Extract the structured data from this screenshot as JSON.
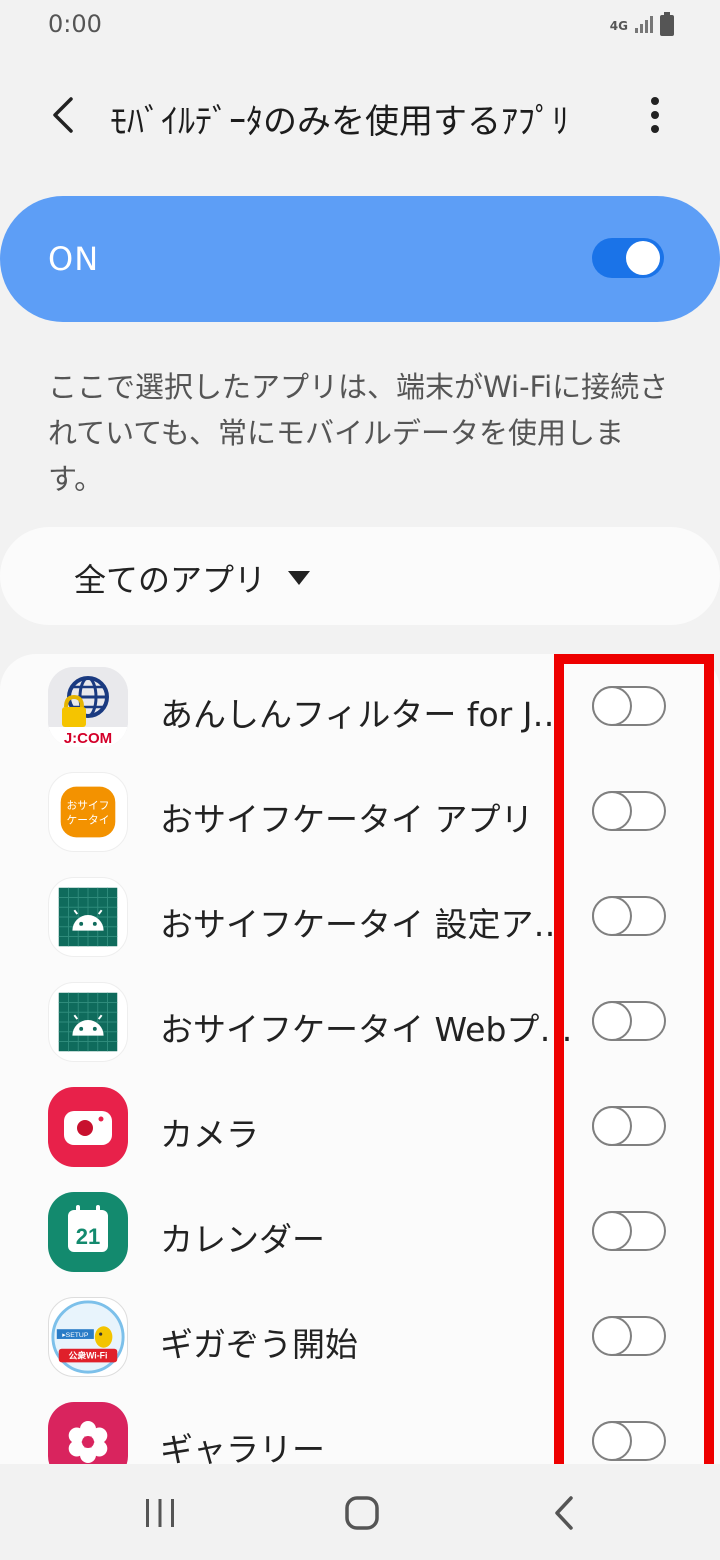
{
  "status_bar": {
    "time": "0:00",
    "network": "4G"
  },
  "header": {
    "title": "ﾓﾊﾞｲﾙﾃﾞｰﾀのみを使用するｱﾌﾟﾘ"
  },
  "master": {
    "label": "ON",
    "state": "on",
    "accent": "#5d9ef6"
  },
  "description": "ここで選択したアプリは、端末がWi-Fiに接続されていても、常にモバイルデータを使用します。",
  "filter": {
    "selected": "全てのアプリ"
  },
  "apps": [
    {
      "name": "あんしんフィルター for J:COM",
      "icon": "anshin-filter-icon",
      "enabled": false
    },
    {
      "name": "おサイフケータイ アプリ",
      "icon": "osaifu-keitai-icon",
      "enabled": false
    },
    {
      "name": "おサイフケータイ 設定アプリ",
      "icon": "android-icon",
      "enabled": false
    },
    {
      "name": "おサイフケータイ Webプラグイン",
      "icon": "android-icon",
      "enabled": false
    },
    {
      "name": "カメラ",
      "icon": "camera-icon",
      "enabled": false
    },
    {
      "name": "カレンダー",
      "icon": "calendar-icon",
      "enabled": false
    },
    {
      "name": "ギガぞう開始",
      "icon": "gigazo-icon",
      "enabled": false
    },
    {
      "name": "ギャラリー",
      "icon": "gallery-icon",
      "enabled": false
    }
  ],
  "icon_texts": {
    "jcom": "J:COM",
    "osaifu_line1": "おサイフ",
    "osaifu_line2": "ケータイ",
    "calendar_day": "21",
    "gigazo_setup": "▸SETUP",
    "gigazo_wifi": "公衆Wi-Fi"
  },
  "colors": {
    "highlight": "#ee0000",
    "toggle_on": "#1a73e8"
  }
}
